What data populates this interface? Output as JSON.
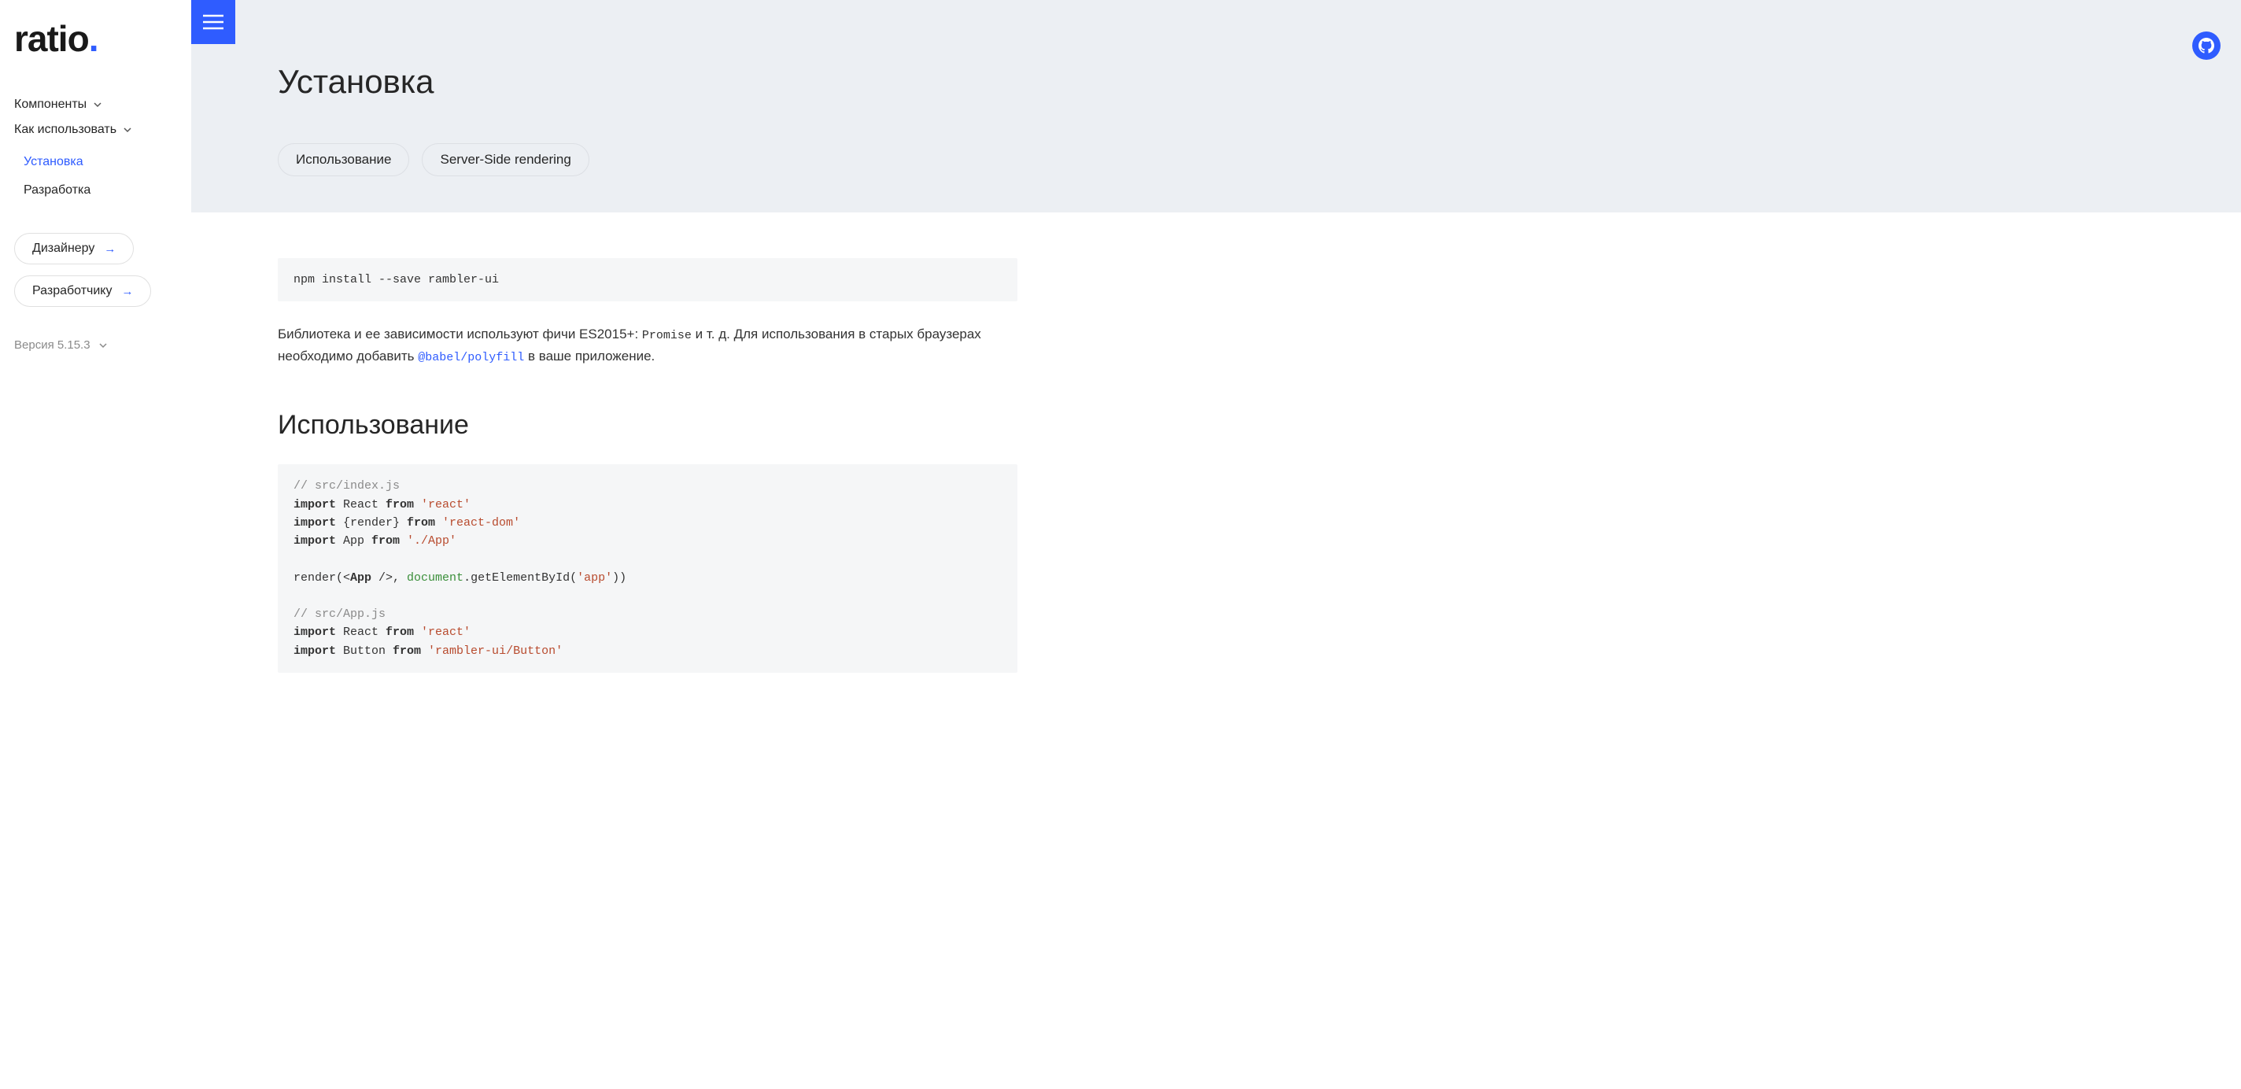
{
  "logo": {
    "text": "ratio",
    "dot": "."
  },
  "sidebar": {
    "navTop": [
      {
        "label": "Компоненты"
      },
      {
        "label": "Как использовать"
      }
    ],
    "subnav": [
      {
        "label": "Установка",
        "active": true
      },
      {
        "label": "Разработка",
        "active": false
      }
    ],
    "pills": [
      {
        "label": "Дизайнеру"
      },
      {
        "label": "Разработчику"
      }
    ],
    "version": "Версия 5.15.3"
  },
  "hero": {
    "title": "Установка",
    "anchors": [
      {
        "label": "Использование"
      },
      {
        "label": "Server-Side rendering"
      }
    ]
  },
  "content": {
    "installCmd": "npm install --save rambler-ui",
    "para1_a": "Библиотека и ее зависимости используют фичи ES2015+: ",
    "para1_code": "Promise",
    "para1_b": " и т. д. Для использования в старых браузерах необходимо добавить ",
    "para1_link": "@babel/polyfill",
    "para1_c": " в ваше приложение.",
    "usageHeading": "Использование",
    "code2": {
      "c1": "// src/index.js",
      "l2_kw1": "import",
      "l2_id": " React ",
      "l2_kw2": "from",
      "l2_str": " 'react'",
      "l3_kw1": "import",
      "l3_id": " {render} ",
      "l3_kw2": "from",
      "l3_str": " 'react-dom'",
      "l4_kw1": "import",
      "l4_id": " App ",
      "l4_kw2": "from",
      "l4_str": " './App'",
      "l6_a": "render(<",
      "l6_tag": "App",
      "l6_b": " />, ",
      "l6_glob": "document",
      "l6_c": ".getElementById(",
      "l6_str": "'app'",
      "l6_d": "))",
      "c2": "// src/App.js",
      "l9_kw1": "import",
      "l9_id": " React ",
      "l9_kw2": "from",
      "l9_str": " 'react'",
      "l10_kw1": "import",
      "l10_id": " Button ",
      "l10_kw2": "from",
      "l10_str": " 'rambler-ui/Button'"
    }
  }
}
